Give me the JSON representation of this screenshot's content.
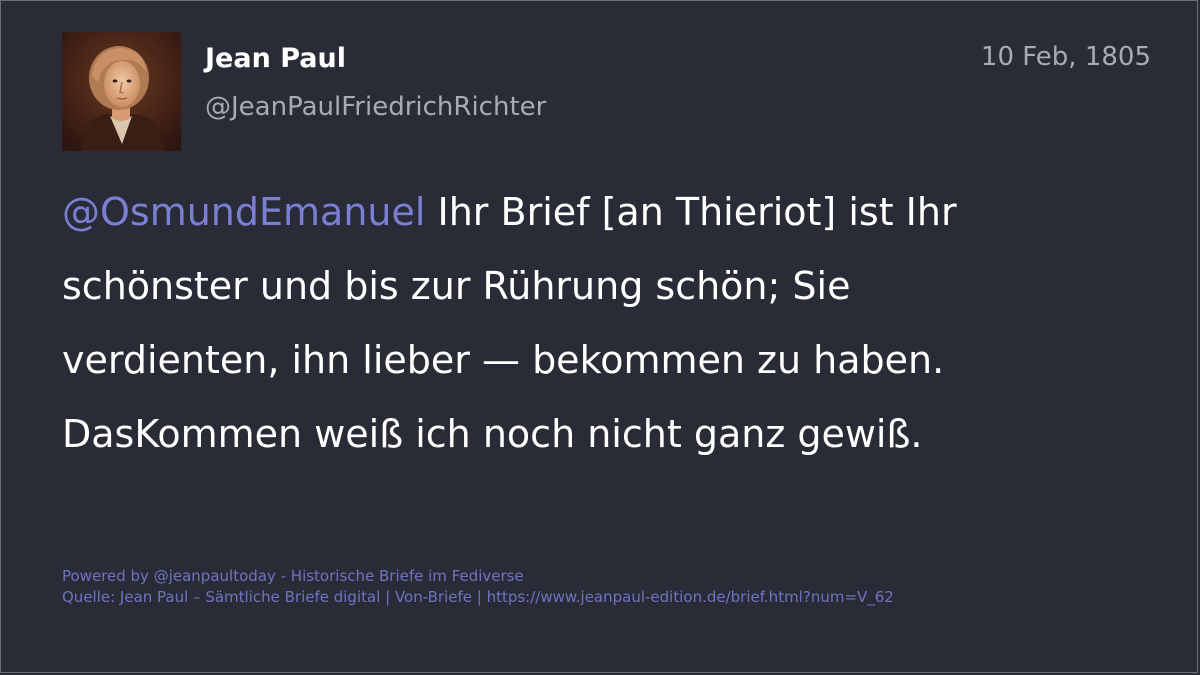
{
  "author": {
    "name": "Jean Paul",
    "handle": "@JeanPaulFriedrichRichter",
    "avatar": "portrait-avatar"
  },
  "post": {
    "date": "10 Feb, 1805",
    "mention": "@OsmundEmanuel",
    "lines": [
      " Ihr Brief [an Thieriot] ist Ihr",
      "schönster und bis zur Rührung schön; Sie",
      "verdienten, ihn lieber — bekommen zu haben.",
      "DasKommen weiß ich noch nicht ganz gewiß."
    ]
  },
  "footer": {
    "powered_by": "Powered by @jeanpaultoday - Historische Briefe im Fediverse",
    "source": "Quelle: Jean Paul – Sämtliche Briefe digital | Von-Briefe | https://www.jeanpaul-edition.de/brief.html?num=V_62"
  },
  "colors": {
    "background": "#292c36",
    "text": "#ffffff",
    "muted": "#a9abb3",
    "mention": "#7b7fd4",
    "footer": "#6f73c2"
  }
}
